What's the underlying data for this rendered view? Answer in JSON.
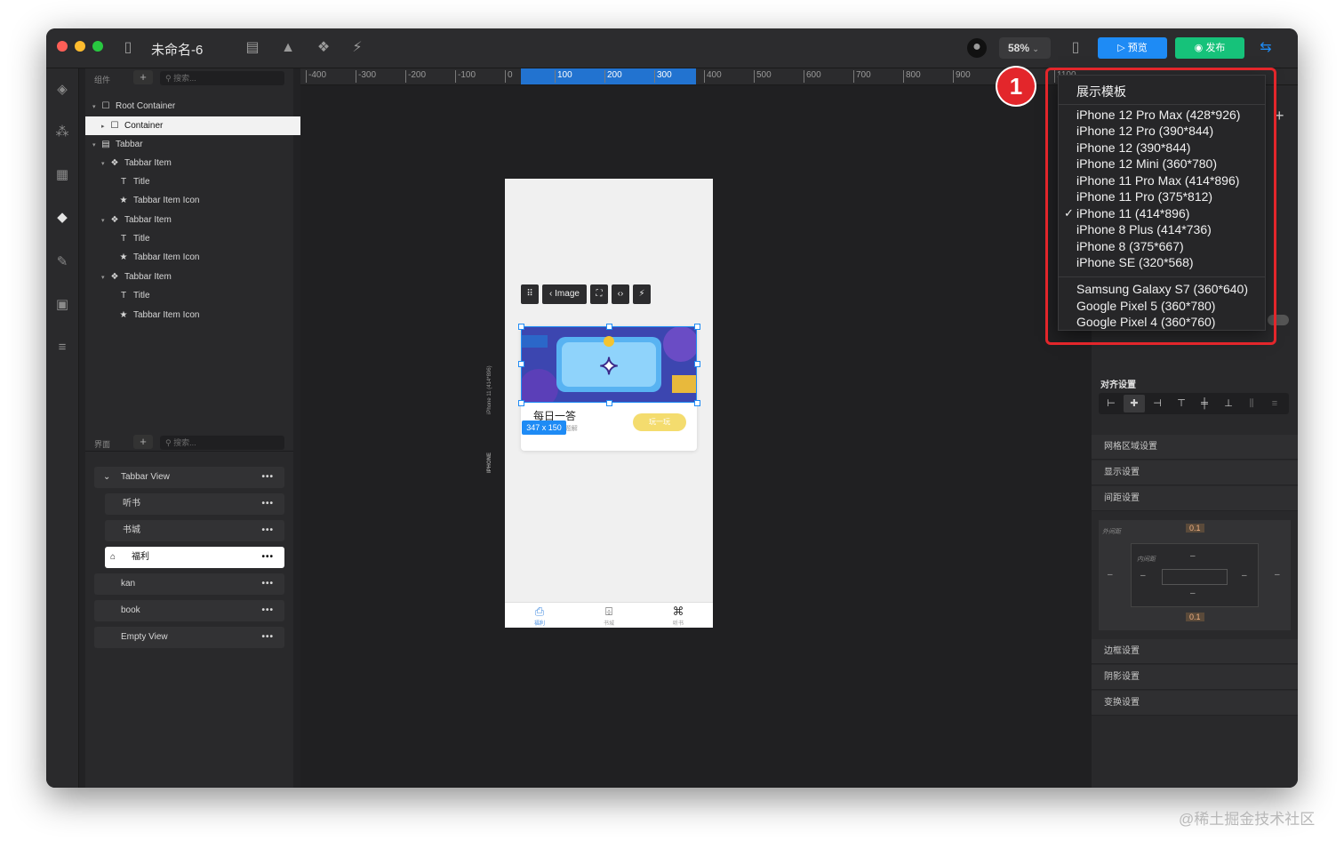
{
  "window": {
    "title": "未命名-6",
    "zoom": "58%"
  },
  "toolbar": {
    "preview_label": "预览",
    "publish_label": "发布"
  },
  "left_rail": [
    "cube-icon",
    "components-icon",
    "grid-icon",
    "layers-icon",
    "pin-icon",
    "pages-icon",
    "list-icon"
  ],
  "components_panel": {
    "header": "组件",
    "search_placeholder": "搜索..."
  },
  "tree": [
    {
      "label": "Root Container"
    },
    {
      "label": "Container"
    },
    {
      "label": "Tabbar"
    },
    {
      "label": "Tabbar Item"
    },
    {
      "label": "Title"
    },
    {
      "label": "Tabbar Item Icon"
    },
    {
      "label": "Tabbar Item"
    },
    {
      "label": "Title"
    },
    {
      "label": "Tabbar Item Icon"
    },
    {
      "label": "Tabbar Item"
    },
    {
      "label": "Title"
    },
    {
      "label": "Tabbar Item Icon"
    }
  ],
  "pages_panel": {
    "header": "界面",
    "search_placeholder": "搜索..."
  },
  "pages": [
    {
      "label": "Tabbar View"
    },
    {
      "label": "听书"
    },
    {
      "label": "书城"
    },
    {
      "label": "福利"
    },
    {
      "label": "kan"
    },
    {
      "label": "book"
    },
    {
      "label": "Empty View"
    }
  ],
  "ruler": [
    "-400",
    "-300",
    "-200",
    "-100",
    "0",
    "100",
    "200",
    "300",
    "400",
    "500",
    "600",
    "700",
    "800",
    "900",
    "1100"
  ],
  "canvas": {
    "device_label": "iPhone 11 (414*896)",
    "side_label": "IPHONE",
    "image_toolbar_label": "Image",
    "size_badge": "347 x 150",
    "card_title": "每日一答",
    "card_subtitle": "连续答对12题解",
    "card_button": "玩一玩",
    "tabs": [
      {
        "icon": "gift-icon",
        "caption": "福利"
      },
      {
        "icon": "book-icon",
        "caption": "书城"
      },
      {
        "icon": "command-icon",
        "caption": "听书"
      }
    ]
  },
  "dropdown": {
    "title": "展示模板",
    "group1": [
      "iPhone 12 Pro Max (428*926)",
      "iPhone 12 Pro (390*844)",
      "iPhone 12 (390*844)",
      "iPhone 12 Mini (360*780)",
      "iPhone 11 Pro Max (414*896)",
      "iPhone 11 Pro (375*812)",
      "iPhone 11 (414*896)",
      "iPhone 8 Plus (414*736)",
      "iPhone 8 (375*667)",
      "iPhone SE (320*568)"
    ],
    "selected": "iPhone 11 (414*896)",
    "group2": [
      "Samsung Galaxy S7 (360*640)",
      "Google Pixel 5 (360*780)",
      "Google Pixel 4 (360*760)"
    ]
  },
  "inspector": {
    "align_title": "对齐设置",
    "sections": [
      "网格区域设置",
      "显示设置",
      "间距设置"
    ],
    "spacing": {
      "outer_label": "外间距",
      "inner_label": "内间距",
      "top": "0.1",
      "bottom": "0.1",
      "dash": "–"
    },
    "sections2": [
      "边框设置",
      "阴影设置",
      "变换设置"
    ]
  },
  "annotation": {
    "marker": "1"
  },
  "watermark": "@稀土掘金技术社区",
  "colors": {
    "accent": "#1e8bf5",
    "publish": "#16c27a",
    "highlight": "#e3262b"
  }
}
